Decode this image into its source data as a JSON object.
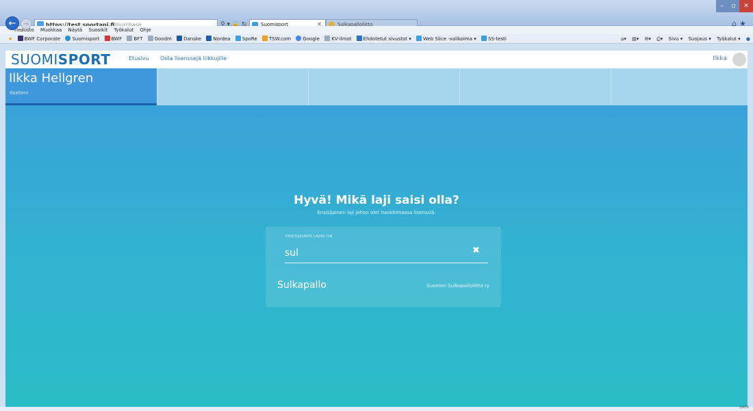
{
  "browser": {
    "url_host": "https://test.sportapi.fi",
    "url_path": "/purchase",
    "url_tools": "⚲ ▾ 🔒 ↻",
    "tabs": [
      {
        "title": "Suomisport",
        "close": "×"
      },
      {
        "title": "Sulkapalloliitto"
      }
    ],
    "menu": [
      "Tiedosto",
      "Muokkaa",
      "Näytä",
      "Suosikit",
      "Työkalut",
      "Ohje"
    ],
    "favorites": [
      {
        "label": "BWF Corporate",
        "color": "#3b2f6e"
      },
      {
        "label": "Suomisport",
        "color": "#2b8ed8"
      },
      {
        "label": "BWF",
        "color": "#d33"
      },
      {
        "label": "BFT",
        "color": "#9ab"
      },
      {
        "label": "Goodm",
        "color": "#9ab"
      },
      {
        "label": "Danske",
        "color": "#1f5a99"
      },
      {
        "label": "Nordea",
        "color": "#1a5fb4"
      },
      {
        "label": "SpoRe",
        "color": "#3aa0e0"
      },
      {
        "label": "TSW.com",
        "color": "#f0a020"
      },
      {
        "label": "Google",
        "color": "#4285f4"
      },
      {
        "label": "KV-ilmot",
        "color": "#9ab"
      },
      {
        "label": "Ehdotetut sivustot ▾",
        "color": "#2d6fc4"
      },
      {
        "label": "Web Slice -valikoima ▾",
        "color": "#3aa0e0"
      },
      {
        "label": "SS-testi",
        "color": "#3aa0e0"
      }
    ],
    "tools_right": [
      "Sivu ▾",
      "Suojaus ▾",
      "Työkalut ▾"
    ],
    "zoom": "100%"
  },
  "site": {
    "logo_light": "SUOMI",
    "logo_bold": "SPORT",
    "nav": [
      "Etusivu",
      "Osta lisenssejä liikkujille"
    ],
    "user": "Ilkka"
  },
  "profile": {
    "name": "Ilkka Hellgren",
    "subtitle": "Itselleni"
  },
  "main": {
    "heading": "Hyvä! Mikä laji saisi olla?",
    "subheading": "Ensisijainen laji johon olet hankkimassa lisenssiä.",
    "field_label": "ENSISIJAINEN LAJINI ON",
    "field_value": "sul",
    "clear": "✖",
    "results": [
      {
        "name": "Sulkapallo",
        "org": "Suomen Sulkapalloliitto ry"
      }
    ]
  },
  "colors": {
    "brand": "#1a6fb8",
    "profile_bg": "#3f98dc",
    "main_top": "#39a2d8",
    "main_bottom": "#2bbdc7"
  }
}
